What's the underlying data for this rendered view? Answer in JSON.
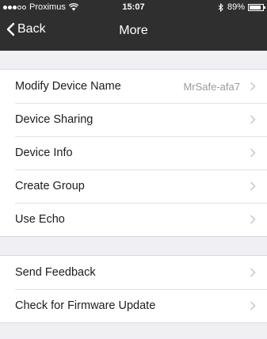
{
  "status_bar": {
    "carrier": "Proximus",
    "time": "15:07",
    "battery_percent": "89%",
    "battery_level": 0.89,
    "signal_strength": 3,
    "signal_max": 5
  },
  "nav": {
    "back_label": "Back",
    "title": "More"
  },
  "groups": [
    {
      "rows": [
        {
          "label": "Modify Device Name",
          "value": "MrSafe-afa7"
        },
        {
          "label": "Device Sharing",
          "value": ""
        },
        {
          "label": "Device Info",
          "value": ""
        },
        {
          "label": "Create Group",
          "value": ""
        },
        {
          "label": "Use Echo",
          "value": ""
        }
      ]
    },
    {
      "rows": [
        {
          "label": "Send Feedback",
          "value": ""
        },
        {
          "label": "Check for Firmware Update",
          "value": ""
        }
      ]
    }
  ],
  "colors": {
    "bar_background": "#2f2f2f",
    "page_background": "#efeff4",
    "chevron": "#c7c7cc"
  },
  "icons": {
    "back": "chevron-left-icon",
    "disclosure": "chevron-right-icon",
    "wifi": "wifi-icon",
    "bluetooth": "bluetooth-icon",
    "battery": "battery-icon"
  }
}
